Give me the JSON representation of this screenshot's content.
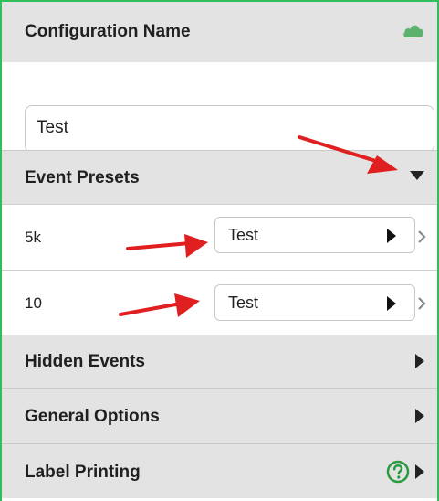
{
  "config": {
    "section_title": "Configuration Name",
    "cloud_icon": "cloud-icon",
    "name_value": "Test"
  },
  "event_presets": {
    "section_title": "Event Presets",
    "expanded": true,
    "rows": [
      {
        "label": "5k",
        "preset": "Test"
      },
      {
        "label": "10",
        "preset": "Test"
      }
    ]
  },
  "sections": {
    "hidden_events": "Hidden Events",
    "general_options": "General Options",
    "label_printing": "Label Printing"
  },
  "colors": {
    "accent_green": "#2fbf5a",
    "section_bg": "#e3e3e3",
    "annotation_red": "#e02020"
  }
}
